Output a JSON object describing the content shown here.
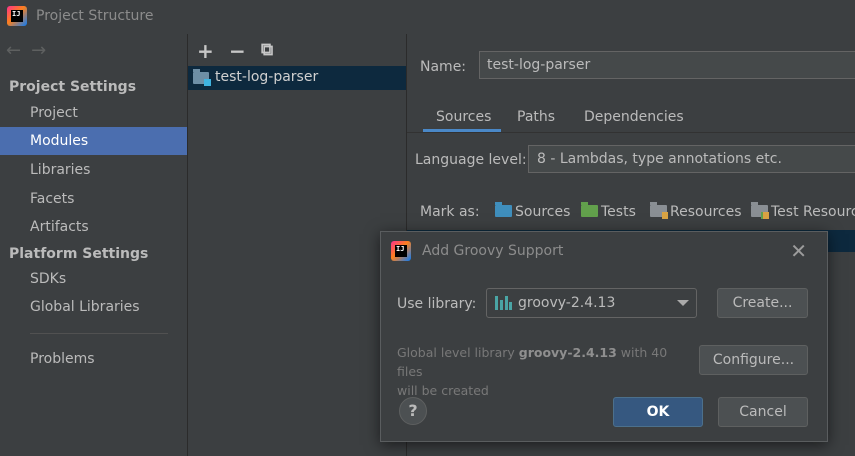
{
  "window": {
    "title": "Project Structure"
  },
  "sidebar": {
    "project_settings_header": "Project Settings",
    "platform_settings_header": "Platform Settings",
    "project_items": [
      {
        "label": "Project"
      },
      {
        "label": "Modules",
        "selected": true
      },
      {
        "label": "Libraries"
      },
      {
        "label": "Facets"
      },
      {
        "label": "Artifacts"
      }
    ],
    "platform_items": [
      {
        "label": "SDKs"
      },
      {
        "label": "Global Libraries"
      }
    ],
    "problems": "Problems"
  },
  "modules": {
    "toolbar": {
      "add": "+",
      "remove": "−",
      "copy": "⧉"
    },
    "items": [
      {
        "label": "test-log-parser",
        "icon": "module-folder-icon"
      }
    ]
  },
  "module_settings": {
    "name_label": "Name:",
    "name_value": "test-log-parser",
    "tabs": [
      {
        "label": "Sources",
        "active": true
      },
      {
        "label": "Paths"
      },
      {
        "label": "Dependencies"
      }
    ],
    "language_level_label": "Language level:",
    "language_level_value": "8 - Lambdas, type annotations etc.",
    "mark_as_label": "Mark as:",
    "mark_as_items": [
      {
        "label": "Sources",
        "icon": "sources-folder-icon"
      },
      {
        "label": "Tests",
        "icon": "tests-folder-icon"
      },
      {
        "label": "Resources",
        "icon": "resources-folder-icon"
      },
      {
        "label": "Test Resourc",
        "icon": "test-resources-folder-icon"
      }
    ]
  },
  "dialog": {
    "title": "Add Groovy Support",
    "use_library_label": "Use library:",
    "library_value": "groovy-2.4.13",
    "create_button": "Create...",
    "configure_button": "Configure...",
    "info_prefix": "Global level library ",
    "info_library": "groovy-2.4.13",
    "info_suffix": " with 40 files",
    "info_line2": "will be created",
    "help_button": "?",
    "ok_button": "OK",
    "cancel_button": "Cancel"
  },
  "colors": {
    "background": "#3c3f41",
    "selection": "#4b6eaf",
    "primary_button": "#365880",
    "tab_underline": "#4a88c7"
  }
}
